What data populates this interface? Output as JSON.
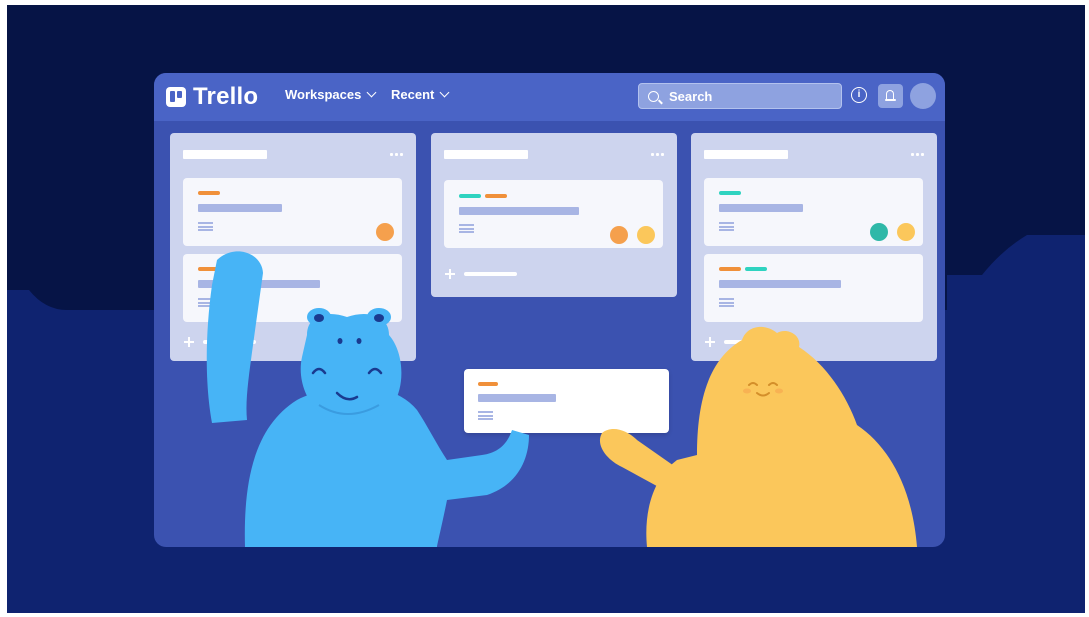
{
  "header": {
    "logo_text": "Trello",
    "nav": [
      {
        "label": "Workspaces"
      },
      {
        "label": "Recent"
      }
    ],
    "search": {
      "placeholder": "Search"
    },
    "info_symbol": "i"
  },
  "colors": {
    "background": "#061446",
    "board": "#3b52b0",
    "topbar": "#4a64c6",
    "label_orange": "#f0903a",
    "label_teal": "#2fd3c0",
    "hippo_blue": "#47b4f6",
    "bird_yellow": "#fbc75b"
  },
  "icons": [
    "trello-logo-icon",
    "chevron-down-icon",
    "search-icon",
    "info-icon",
    "bell-icon",
    "avatar",
    "more-dots-icon",
    "plus-icon"
  ]
}
